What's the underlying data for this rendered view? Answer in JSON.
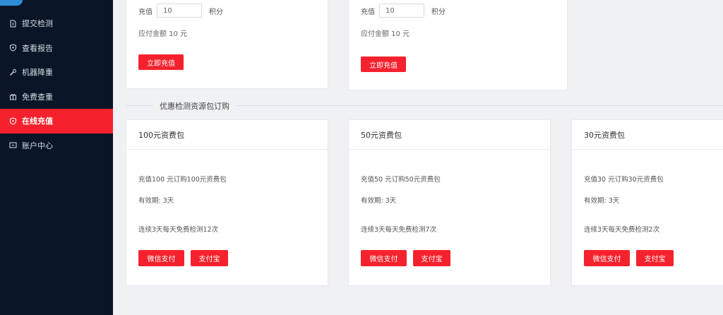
{
  "sidebar": {
    "items": [
      {
        "label": "提交检测",
        "icon": "document-icon",
        "active": false
      },
      {
        "label": "查看报告",
        "icon": "shield-icon",
        "active": false
      },
      {
        "label": "机器降重",
        "icon": "wrench-icon",
        "active": false
      },
      {
        "label": "免费查重",
        "icon": "gift-icon",
        "active": false
      },
      {
        "label": "在线充值",
        "icon": "shield-icon",
        "active": true
      },
      {
        "label": "账户中心",
        "icon": "monitor-icon",
        "active": false
      }
    ]
  },
  "recharge_cards": [
    {
      "label": "充值",
      "value": "10",
      "unit": "积分",
      "amount": "应付金额 10 元",
      "button": "立即充值"
    },
    {
      "label": "充值",
      "value": "10",
      "unit": "积分",
      "amount": "应付金额 10 元",
      "button": "立即充值"
    }
  ],
  "section_title": "优惠检测资源包订购",
  "packages": [
    {
      "title": "100元资费包",
      "desc": "充值100 元订购100元资费包",
      "validity": "有效期: 3天",
      "benefit": "连续3天每天免费检测12次",
      "wechat": "微信支付",
      "alipay": "支付宝"
    },
    {
      "title": "50元资费包",
      "desc": "充值50 元订购50元资费包",
      "validity": "有效期: 3天",
      "benefit": "连续3天每天免费检测7次",
      "wechat": "微信支付",
      "alipay": "支付宝"
    },
    {
      "title": "30元资费包",
      "desc": "充值30 元订购30元资费包",
      "validity": "有效期: 3天",
      "benefit": "连续3天每天免费检测2次",
      "wechat": "微信支付",
      "alipay": "支付宝"
    }
  ],
  "colors": {
    "sidebar_bg": "#0a1628",
    "accent": "#f5222d",
    "page_bg": "#f0f1f5"
  }
}
